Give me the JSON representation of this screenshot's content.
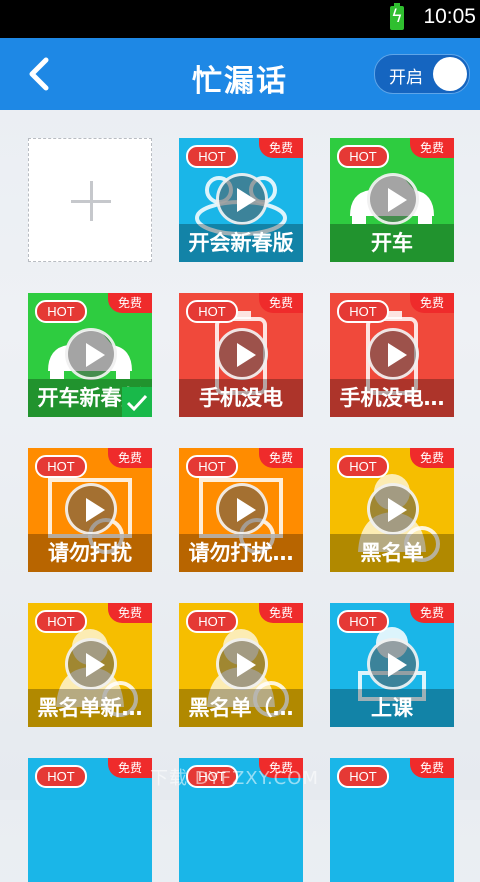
{
  "status_bar": {
    "time": "10:05"
  },
  "header": {
    "title": "忙漏话",
    "toggle_label": "开启"
  },
  "colors": {
    "header": "#1e88e5",
    "blue": "#1ab6e8",
    "green": "#2ecc40",
    "red": "#f0493b",
    "orange": "#ff8c00",
    "yellow": "#f6be00"
  },
  "badges": {
    "hot": "HOT",
    "free": "免费"
  },
  "tiles": [
    {
      "caption": "开会新春版",
      "color": "#1ab6e8",
      "icon": "meeting-people-icon"
    },
    {
      "caption": "开车",
      "color": "#2ecc40",
      "icon": "car-icon"
    },
    {
      "caption": "开车新春版",
      "color": "#2ecc40",
      "icon": "car-icon",
      "selected": true
    },
    {
      "caption": "手机没电",
      "color": "#f0493b",
      "icon": "battery-low-icon"
    },
    {
      "caption": "手机没电…",
      "color": "#f0493b",
      "icon": "battery-low-icon"
    },
    {
      "caption": "请勿打扰",
      "color": "#ff8c00",
      "icon": "do-not-disturb-icon"
    },
    {
      "caption": "请勿打扰…",
      "color": "#ff8c00",
      "icon": "do-not-disturb-icon"
    },
    {
      "caption": "黑名单",
      "color": "#f6be00",
      "icon": "blacklist-person-icon"
    },
    {
      "caption": "黑名单新…",
      "color": "#f6be00",
      "icon": "blacklist-person-icon"
    },
    {
      "caption": "黑名单（…",
      "color": "#f6be00",
      "icon": "blacklist-person-icon"
    },
    {
      "caption": "上课",
      "color": "#1ab6e8",
      "icon": "classroom-icon"
    },
    {
      "caption": "",
      "color": "#1ab6e8",
      "icon": ""
    },
    {
      "caption": "",
      "color": "#1ab6e8",
      "icon": ""
    },
    {
      "caption": "",
      "color": "#1ab6e8",
      "icon": ""
    }
  ],
  "watermark": "下载 DYFZXY.COM"
}
